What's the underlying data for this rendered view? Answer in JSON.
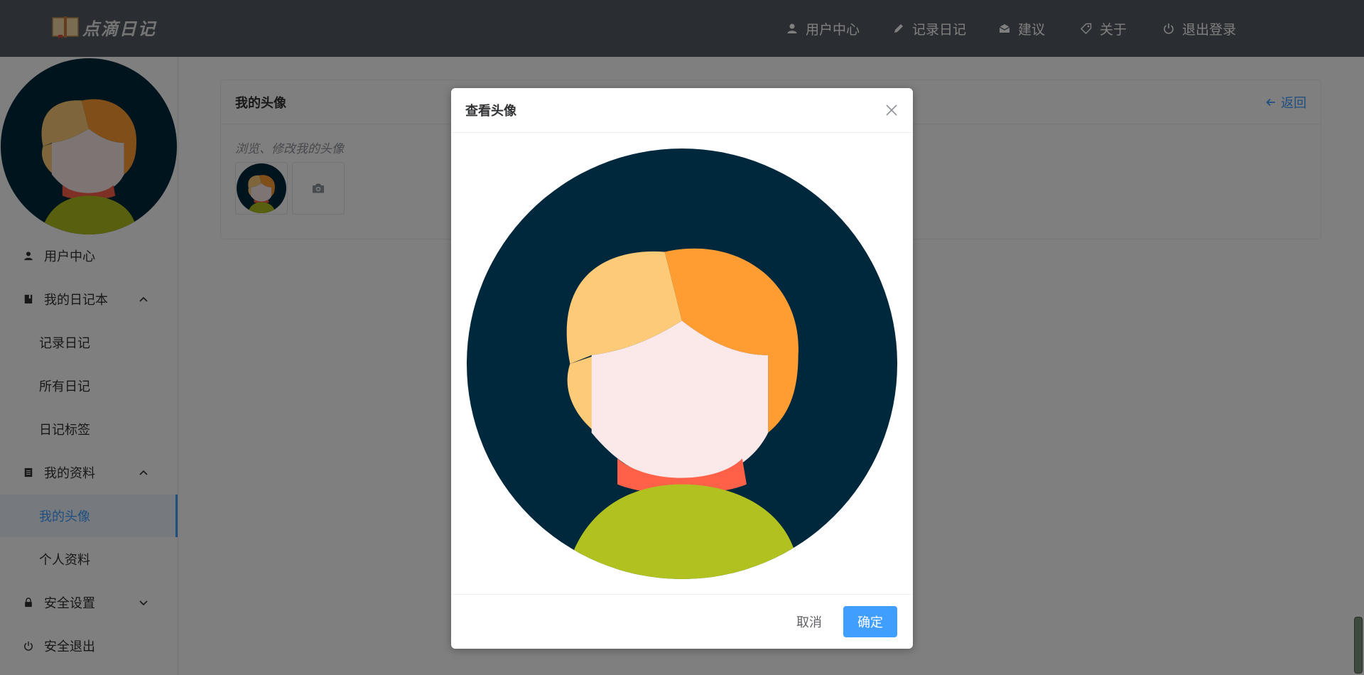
{
  "header": {
    "logo_text": "点滴日记",
    "nav": [
      {
        "label": "用户中心",
        "icon": "user-icon"
      },
      {
        "label": "记录日记",
        "icon": "pencil-icon"
      },
      {
        "label": "建议",
        "icon": "mail-icon"
      },
      {
        "label": "关于",
        "icon": "tag-icon"
      },
      {
        "label": "退出登录",
        "icon": "power-icon"
      }
    ]
  },
  "sidebar": {
    "items": [
      {
        "label": "用户中心",
        "icon": "user-icon"
      },
      {
        "label": "我的日记本",
        "icon": "notebook-icon",
        "expanded": true
      },
      {
        "label": "记录日记"
      },
      {
        "label": "所有日记"
      },
      {
        "label": "日记标签"
      },
      {
        "label": "我的资料",
        "icon": "document-icon",
        "expanded": true
      },
      {
        "label": "我的头像",
        "active": true
      },
      {
        "label": "个人资料"
      },
      {
        "label": "安全设置",
        "icon": "lock-icon",
        "expanded": false
      },
      {
        "label": "安全退出",
        "icon": "power-icon"
      }
    ]
  },
  "main": {
    "title": "我的头像",
    "back_label": "返回",
    "subtitle": "浏览、修改我的头像"
  },
  "dialog": {
    "title": "查看头像",
    "cancel_label": "取消",
    "confirm_label": "确定"
  },
  "colors": {
    "header_bg": "#545c64",
    "accent": "#409eff",
    "avatar_bg": "#00283d",
    "hair_light": "#fdca78",
    "hair_dark": "#ff9d33",
    "face": "#fbe8e8",
    "collar": "#ff6048",
    "shirt": "#b1c11f"
  }
}
